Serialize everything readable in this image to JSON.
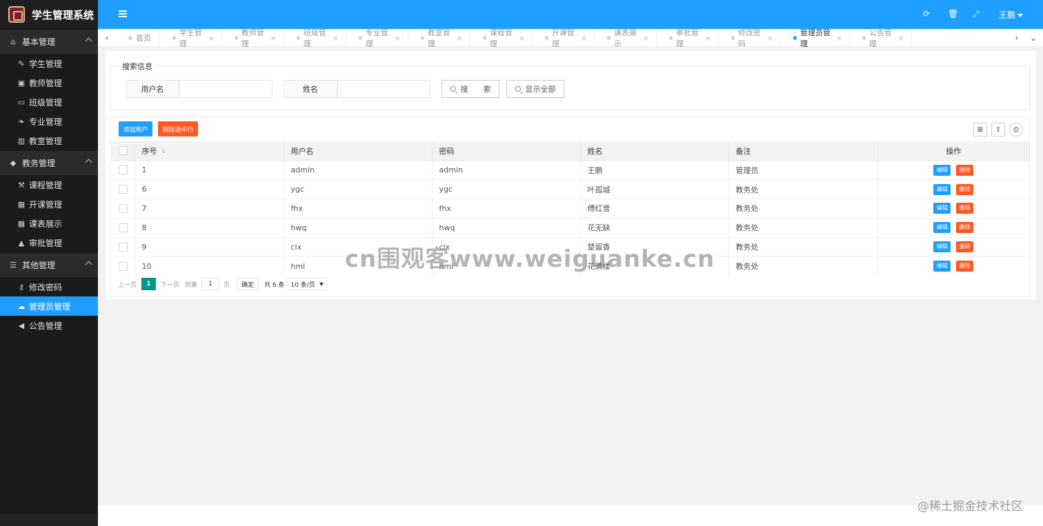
{
  "app": {
    "title": "学生管理系统"
  },
  "sidebar": {
    "groups": [
      {
        "label": "基本管理",
        "icon": "home-icon",
        "items": [
          {
            "label": "学生管理",
            "icon": "pencil-icon"
          },
          {
            "label": "教师管理",
            "icon": "briefcase-icon"
          },
          {
            "label": "班级管理",
            "icon": "window-icon"
          },
          {
            "label": "专业管理",
            "icon": "leaf-icon"
          },
          {
            "label": "教室管理",
            "icon": "bank-icon"
          }
        ]
      },
      {
        "label": "教务管理",
        "icon": "graduation-cap-icon",
        "items": [
          {
            "label": "课程管理",
            "icon": "gavel-icon"
          },
          {
            "label": "开课管理",
            "icon": "calendar-icon"
          },
          {
            "label": "课表展示",
            "icon": "table-icon"
          },
          {
            "label": "审批管理",
            "icon": "stamp-icon"
          }
        ]
      },
      {
        "label": "其他管理",
        "icon": "list-icon",
        "items": [
          {
            "label": "修改密码",
            "icon": "key-icon"
          },
          {
            "label": "管理员管理",
            "icon": "cloud-icon"
          },
          {
            "label": "公告管理",
            "icon": "bullhorn-icon"
          }
        ]
      }
    ],
    "active": "管理员管理"
  },
  "header": {
    "user_name": "王鹏",
    "icons": [
      "menu-toggle-icon",
      "refresh-icon",
      "trash-icon",
      "fullscreen-icon",
      "more-vertical-icon"
    ],
    "accent": "#1e9fff"
  },
  "tabs": [
    "首页",
    "学生管理",
    "教师管理",
    "班级管理",
    "专业管理",
    "教室管理",
    "课程管理",
    "开课管理",
    "课表展示",
    "审批管理",
    "修改密码",
    "管理员管理",
    "公告管理"
  ],
  "active_tab": "管理员管理",
  "search": {
    "legend": "搜索信息",
    "username_label": "用户名",
    "username_value": "",
    "name_label": "姓名",
    "name_value": "",
    "search_button": "搜　　索",
    "show_all_button": "显示全部"
  },
  "toolbar": {
    "add_label": "添加用户",
    "delete_selected_label": "删除选中行",
    "add_color": "#1e9fff",
    "delete_color": "#ff5722"
  },
  "table": {
    "columns": [
      "序号",
      "用户名",
      "密码",
      "姓名",
      "备注",
      "操作"
    ],
    "rows": [
      {
        "id": "1",
        "username": "admin",
        "password": "admin",
        "name": "王鹏",
        "remark": "管理员"
      },
      {
        "id": "6",
        "username": "ygc",
        "password": "ygc",
        "name": "叶孤城",
        "remark": "教务处"
      },
      {
        "id": "7",
        "username": "fhx",
        "password": "fhx",
        "name": "傅红雪",
        "remark": "教务处"
      },
      {
        "id": "8",
        "username": "hwq",
        "password": "hwq",
        "name": "花无缺",
        "remark": "教务处"
      },
      {
        "id": "9",
        "username": "clx",
        "password": "clx",
        "name": "楚留香",
        "remark": "教务处"
      },
      {
        "id": "10",
        "username": "hml",
        "password": "hml",
        "name": "花满楼",
        "remark": "教务处"
      }
    ],
    "edit_label": "编辑",
    "delete_label": "删除"
  },
  "pager": {
    "prev": "上一页",
    "current": "1",
    "next": "下一页",
    "goto_label": "到第",
    "goto_value": "1",
    "page_unit": "页",
    "confirm": "确定",
    "total": "共 6 条",
    "page_size": "10 条/页"
  },
  "watermark": "cn围观客www.weiguanke.cn",
  "corner_watermark": "@稀土掘金技术社区"
}
